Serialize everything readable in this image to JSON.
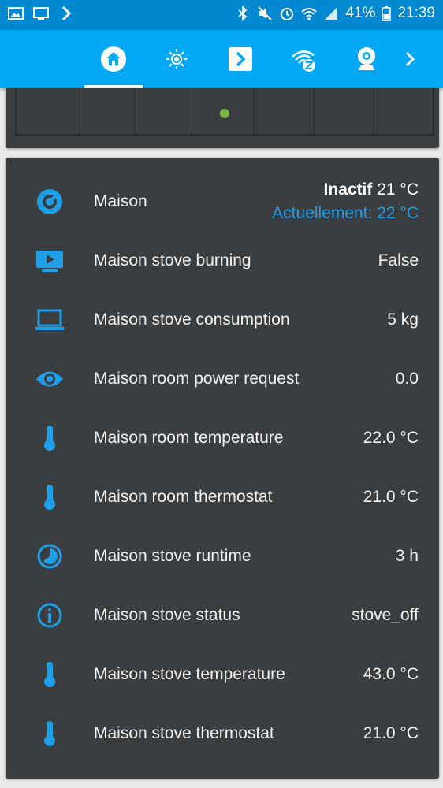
{
  "status_bar": {
    "battery_percent": "41%",
    "time": "21:39",
    "bar_color": "#0288d1"
  },
  "toolbar": {
    "color": "#03a9f4",
    "tabs": [
      {
        "icon": "home-icon",
        "active": true
      },
      {
        "icon": "brightness-icon",
        "active": false
      },
      {
        "icon": "chevron-box-icon",
        "active": false
      },
      {
        "icon": "wifi-z-icon",
        "active": false
      },
      {
        "icon": "webcam-icon",
        "active": false
      }
    ],
    "more_icon": "chevron-right-icon"
  },
  "accent_color": "#1e9fe8",
  "entities": {
    "climate": {
      "name": "Maison",
      "state": "Inactif",
      "target": "21 °C",
      "current": "Actuellement: 22 °C",
      "icon": "thermostat-dial-icon"
    },
    "rows": [
      {
        "name": "Maison stove burning",
        "value": "False",
        "icon": "tv-play-icon"
      },
      {
        "name": "Maison stove consumption",
        "value": "5 kg",
        "icon": "laptop-icon"
      },
      {
        "name": "Maison room power request",
        "value": "0.0",
        "icon": "eye-icon"
      },
      {
        "name": "Maison room temperature",
        "value": "22.0 °C",
        "icon": "thermometer-icon"
      },
      {
        "name": "Maison room thermostat",
        "value": "21.0 °C",
        "icon": "thermometer-icon"
      },
      {
        "name": "Maison stove runtime",
        "value": "3 h",
        "icon": "timelapse-icon"
      },
      {
        "name": "Maison stove status",
        "value": "stove_off",
        "icon": "info-icon"
      },
      {
        "name": "Maison stove temperature",
        "value": "43.0 °C",
        "icon": "thermometer-icon"
      },
      {
        "name": "Maison stove thermostat",
        "value": "21.0 °C",
        "icon": "thermometer-icon"
      }
    ]
  }
}
